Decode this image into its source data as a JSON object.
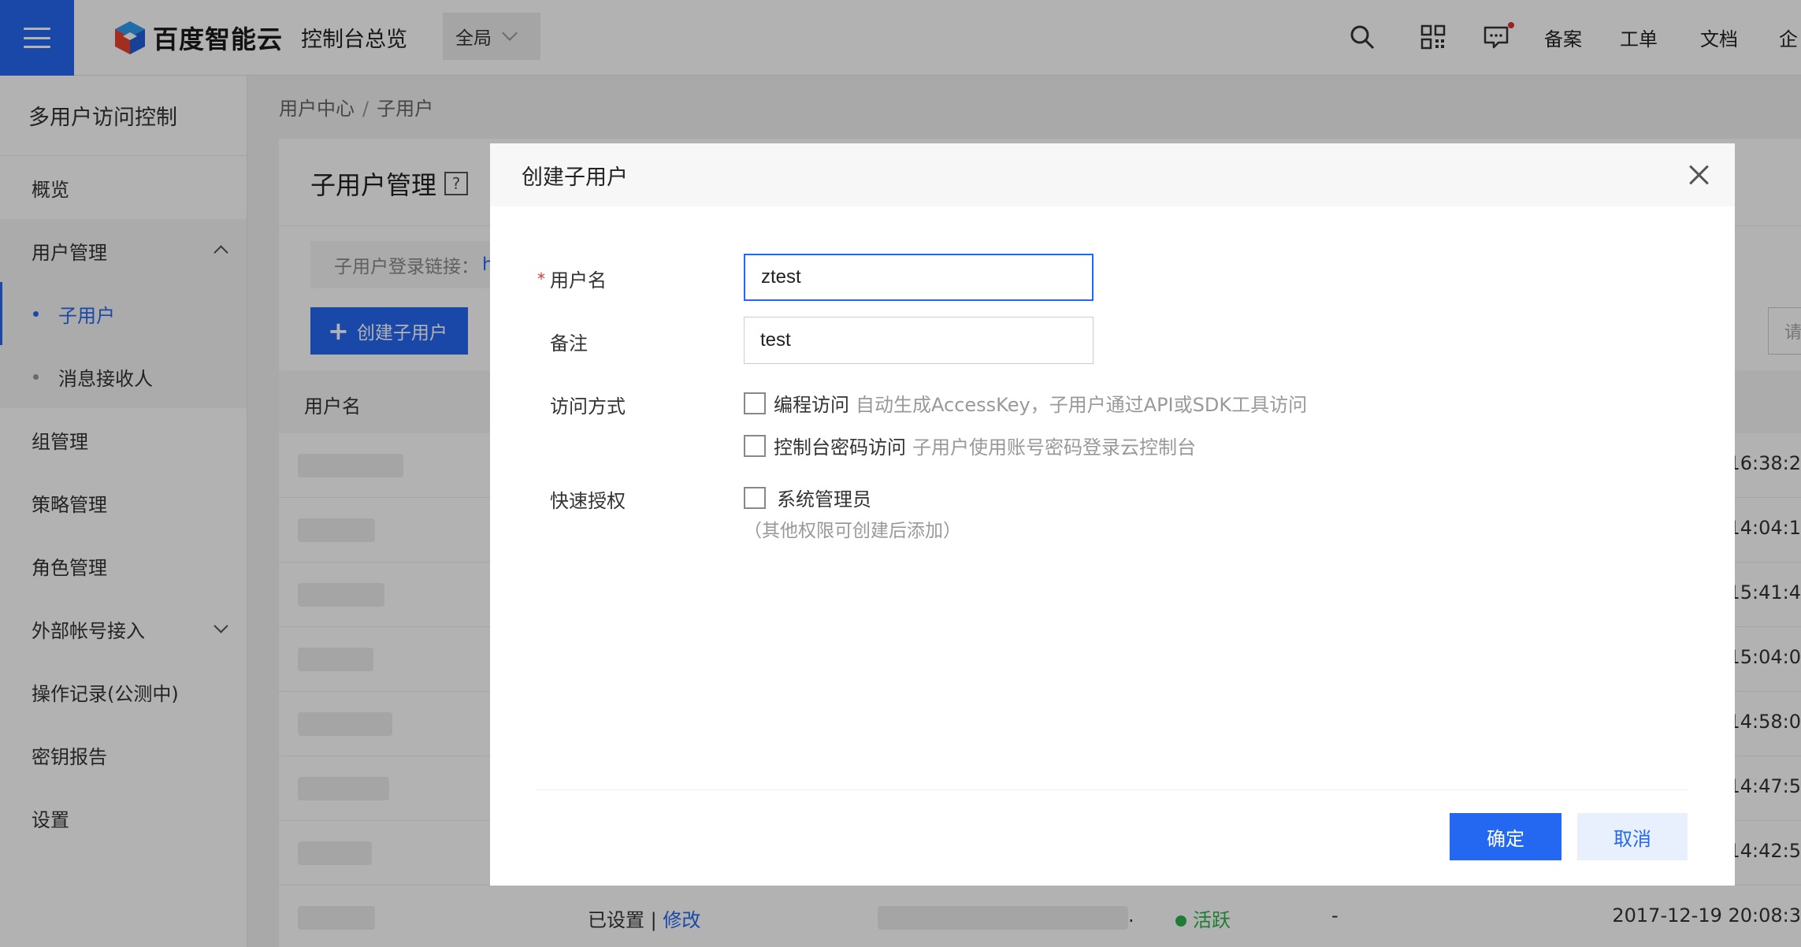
{
  "topbar": {
    "logo_text": "百度智能云",
    "console_title": "控制台总览",
    "region": "全局",
    "links": [
      "备案",
      "工单",
      "文档",
      "企"
    ],
    "icons": [
      "search-icon",
      "qr-code-icon",
      "message-icon"
    ],
    "colors": {
      "accent": "#2468f2",
      "badge": "#e0312c"
    }
  },
  "sidebar": {
    "title": "多用户访问控制",
    "items": {
      "overview": "概览",
      "user_mgmt": "用户管理",
      "sub_user": "子用户",
      "msg_receiver": "消息接收人",
      "group_mgmt": "组管理",
      "policy_mgmt": "策略管理",
      "role_mgmt": "角色管理",
      "external_account": "外部帐号接入",
      "op_log": "操作记录(公测中)",
      "key_report": "密钥报告",
      "settings": "设置"
    }
  },
  "breadcrumb": {
    "parent": "用户中心",
    "separator": "/",
    "current": "子用户"
  },
  "main": {
    "title": "子用户管理",
    "help_glyph": "?",
    "login_link_label": "子用户登录链接：",
    "login_link_prefix": "h",
    "create_button": "创建子用户",
    "search_placeholder": "请",
    "table": {
      "col_username": "用户名",
      "row_times": [
        "16:38:2",
        "14:04:1",
        "15:41:4",
        "15:04:0",
        "14:58:0",
        "14:47:5",
        "14:42:5"
      ],
      "last_row": {
        "pw_status": "已设置",
        "divider": "|",
        "edit": "修改",
        "dot": ".",
        "status": "活跃",
        "dash": "-",
        "time": "2017-12-19 20:08:3"
      }
    }
  },
  "modal": {
    "title": "创建子用户",
    "username_label": "用户名",
    "required_mark": "*",
    "username_value": "ztest",
    "remark_label": "备注",
    "remark_value": "test",
    "access_label": "访问方式",
    "access_prog": "编程访问",
    "access_prog_hint": "自动生成AccessKey，子用户通过API或SDK工具访问",
    "access_console": "控制台密码访问",
    "access_console_hint": "子用户使用账号密码登录云控制台",
    "quick_auth_label": "快速授权",
    "sys_admin": "系统管理员",
    "sys_admin_note": "（其他权限可创建后添加）",
    "confirm": "确定",
    "cancel": "取消"
  }
}
